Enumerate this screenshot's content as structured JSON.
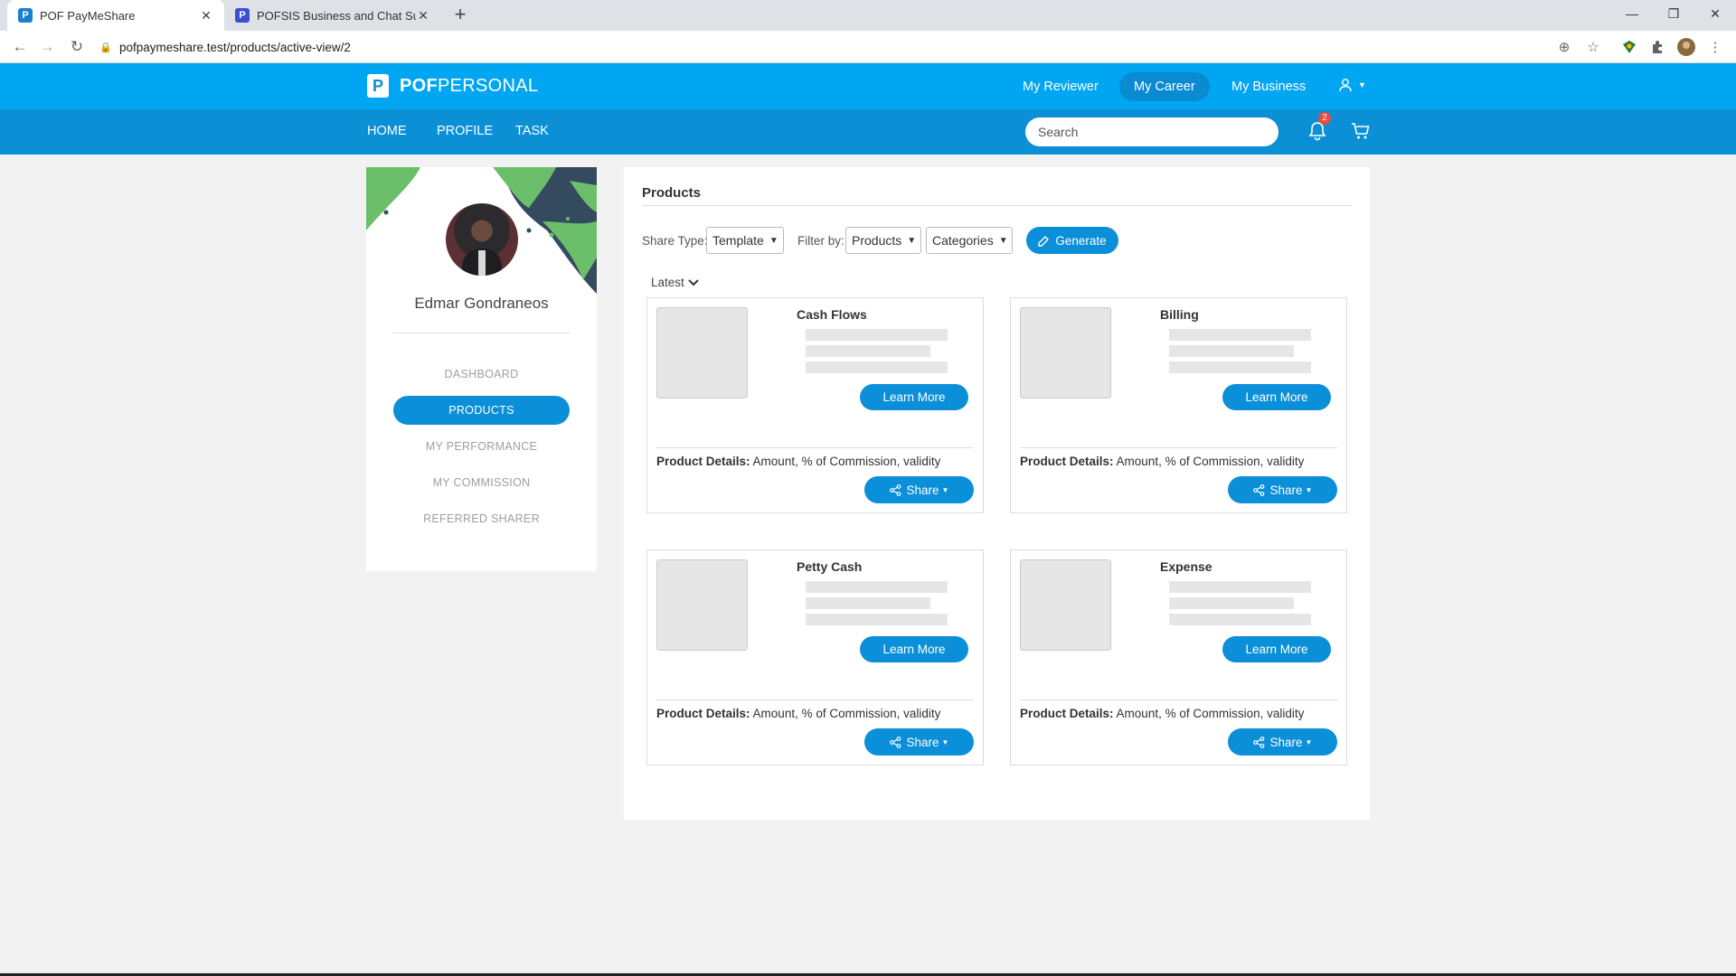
{
  "browser": {
    "tabs": [
      {
        "title": "POF PayMeShare",
        "active": true
      },
      {
        "title": "POFSIS Business and Chat Suppo",
        "active": false
      }
    ],
    "url": "pofpaymeshare.test/products/active-view/2"
  },
  "header": {
    "brand_bold": "POF",
    "brand_light": "PERSONAL",
    "top_links": [
      "My Reviewer",
      "My Career",
      "My Business"
    ],
    "active_top_link": "My Career",
    "sub_links": [
      "HOME",
      "PROFILE",
      "TASK"
    ],
    "search_placeholder": "Search",
    "notification_count": "2"
  },
  "sidebar": {
    "user_name": "Edmar Gondraneos",
    "items": [
      "DASHBOARD",
      "PRODUCTS",
      "MY PERFORMANCE",
      "MY COMMISSION",
      "REFERRED SHARER"
    ],
    "active_item": "PRODUCTS"
  },
  "main": {
    "title": "Products",
    "share_type_label": "Share Type:",
    "share_type_value": "Template",
    "filter_by_label": "Filter by:",
    "filter_products_value": "Products",
    "filter_categories_value": "Categories",
    "generate_label": "Generate",
    "sort_label": "Latest",
    "products": [
      {
        "name": "Cash Flows",
        "learn_more": "Learn More",
        "details_label": "Product Details:",
        "details_text": "Amount, % of Commission, validity",
        "share_label": "Share"
      },
      {
        "name": "Billing",
        "learn_more": "Learn More",
        "details_label": "Product Details:",
        "details_text": "Amount, % of Commission, validity",
        "share_label": "Share"
      },
      {
        "name": "Petty Cash",
        "learn_more": "Learn More",
        "details_label": "Product Details:",
        "details_text": "Amount, % of Commission, validity",
        "share_label": "Share"
      },
      {
        "name": "Expense",
        "learn_more": "Learn More",
        "details_label": "Product Details:",
        "details_text": "Amount, % of Commission, validity",
        "share_label": "Share"
      }
    ]
  },
  "colors": {
    "primary": "#00a6f1",
    "primary_dark": "#0b8fd9",
    "page_bg": "#f2f2f2"
  }
}
